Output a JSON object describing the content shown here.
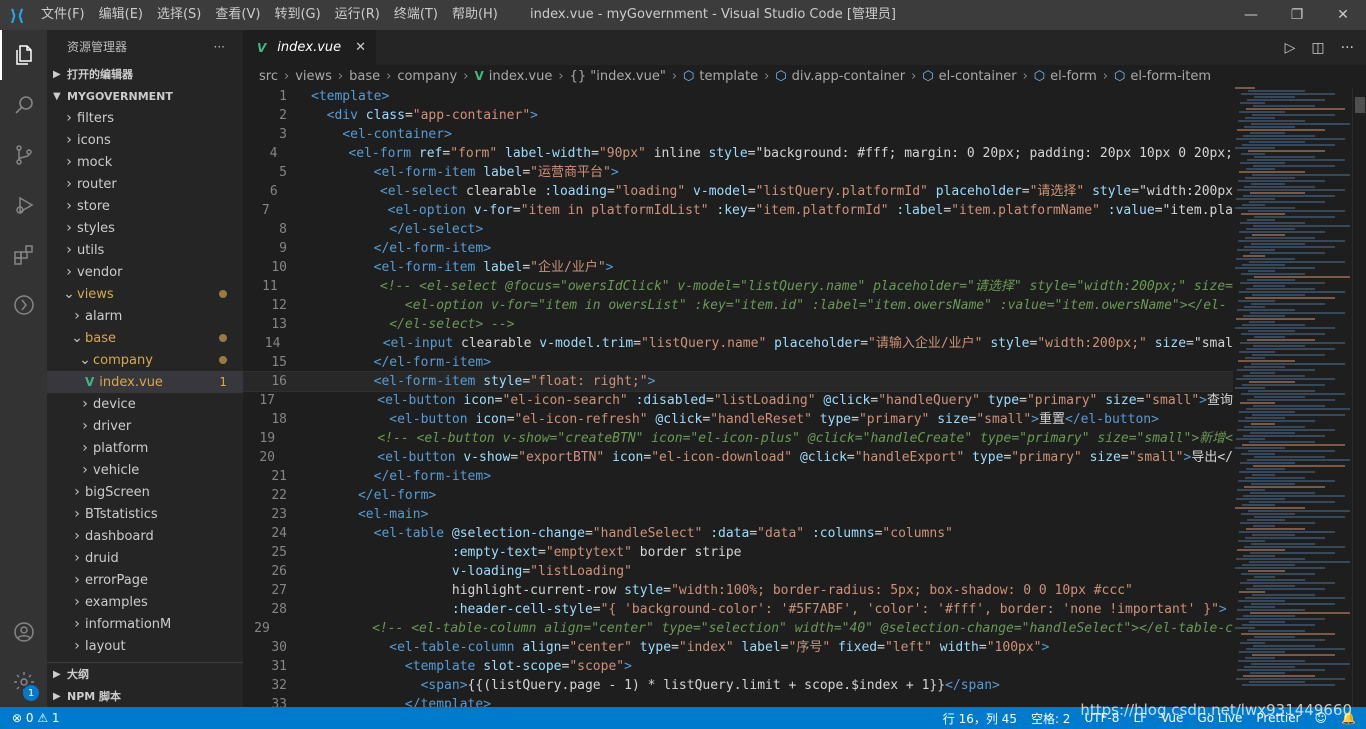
{
  "titlebar": {
    "menus": [
      "文件(F)",
      "编辑(E)",
      "选择(S)",
      "查看(V)",
      "转到(G)",
      "运行(R)",
      "终端(T)",
      "帮助(H)"
    ],
    "title": "index.vue - myGovernment - Visual Studio Code [管理员]"
  },
  "sidebar": {
    "title": "资源管理器",
    "more": "···",
    "open_editors": "打开的编辑器",
    "project": "MYGOVERNMENT",
    "outline": "大纲",
    "npm": "NPM 脚本",
    "tree": [
      {
        "label": "filters"
      },
      {
        "label": "icons"
      },
      {
        "label": "mock"
      },
      {
        "label": "router"
      },
      {
        "label": "store"
      },
      {
        "label": "styles"
      },
      {
        "label": "utils"
      },
      {
        "label": "vendor"
      },
      {
        "label": "views"
      },
      {
        "label": "alarm"
      },
      {
        "label": "base"
      },
      {
        "label": "company"
      },
      {
        "label": "index.vue",
        "count": "1"
      },
      {
        "label": "device"
      },
      {
        "label": "driver"
      },
      {
        "label": "platform"
      },
      {
        "label": "vehicle"
      },
      {
        "label": "bigScreen"
      },
      {
        "label": "BTstatistics"
      },
      {
        "label": "dashboard"
      },
      {
        "label": "druid"
      },
      {
        "label": "errorPage"
      },
      {
        "label": "examples"
      },
      {
        "label": "informationM"
      },
      {
        "label": "layout"
      }
    ]
  },
  "activity": {
    "badge": "1"
  },
  "editor": {
    "tab_label": "index.vue",
    "breadcrumb": [
      "src",
      "views",
      "base",
      "company",
      "index.vue",
      "{} \"index.vue\"",
      "template",
      "div.app-container",
      "el-container",
      "el-form",
      "el-form-item"
    ],
    "lines": [
      "<template>",
      "  <div class=\"app-container\">",
      "    <el-container>",
      "      <el-form ref=\"form\" label-width=\"90px\" inline style=\"background: #fff; margin: 0 20px; padding: 20px 10px 0 20px;",
      "        <el-form-item label=\"运营商平台\">",
      "          <el-select clearable :loading=\"loading\" v-model=\"listQuery.platformId\" placeholder=\"请选择\" style=\"width:200px",
      "            <el-option v-for=\"item in platformIdList\" :key=\"item.platformId\" :label=\"item.platformName\" :value=\"item.pla",
      "          </el-select>",
      "        </el-form-item>",
      "        <el-form-item label=\"企业/业户\">",
      "          <!-- <el-select @focus=\"owersIdClick\" v-model=\"listQuery.name\" placeholder=\"请选择\" style=\"width:200px;\" size=",
      "            <el-option v-for=\"item in owersList\" :key=\"item.id\" :label=\"item.owersName\" :value=\"item.owersName\"></el-",
      "          </el-select> -->",
      "          <el-input clearable v-model.trim=\"listQuery.name\" placeholder=\"请输入企业/业户\" style=\"width:200px;\" size=\"smal",
      "        </el-form-item>",
      "        <el-form-item style=\"float: right;\">",
      "          <el-button icon=\"el-icon-search\" :disabled=\"listLoading\" @click=\"handleQuery\" type=\"primary\" size=\"small\">查询",
      "          <el-button icon=\"el-icon-refresh\" @click=\"handleReset\" type=\"primary\" size=\"small\">重置</el-button>",
      "          <!-- <el-button v-show=\"createBTN\" icon=\"el-icon-plus\" @click=\"handleCreate\" type=\"primary\" size=\"small\">新增<",
      "          <el-button v-show=\"exportBTN\" icon=\"el-icon-download\" @click=\"handleExport\" type=\"primary\" size=\"small\">导出</",
      "        </el-form-item>",
      "      </el-form>",
      "      <el-main>",
      "        <el-table @selection-change=\"handleSelect\" :data=\"data\" :columns=\"columns\"",
      "                  :empty-text=\"emptytext\" border stripe",
      "                  v-loading=\"listLoading\"",
      "                  highlight-current-row style=\"width:100%; border-radius: 5px; box-shadow: 0 0 10px #ccc\"",
      "                  :header-cell-style=\"{ 'background-color': '#5F7ABF', 'color': '#fff', border: 'none !important' }\">",
      "          <!-- <el-table-column align=\"center\" type=\"selection\" width=\"40\" @selection-change=\"handleSelect\"></el-table-c",
      "          <el-table-column align=\"center\" type=\"index\" label=\"序号\" fixed=\"left\" width=\"100px\">",
      "            <template slot-scope=\"scope\">",
      "              <span>{{(listQuery.page - 1) * listQuery.limit + scope.$index + 1}}</span>",
      "            </template>"
    ],
    "current_line": 16
  },
  "statusbar": {
    "problems": "⊗ 0 ⚠ 1",
    "position": "行 16，列 45",
    "spaces": "空格: 2",
    "encoding": "UTF-8",
    "eol": "LF",
    "language": "Vue",
    "golive": "Go Live",
    "prettier": "Prettier"
  },
  "watermark": "https://blog.csdn.net/lwx931449660"
}
